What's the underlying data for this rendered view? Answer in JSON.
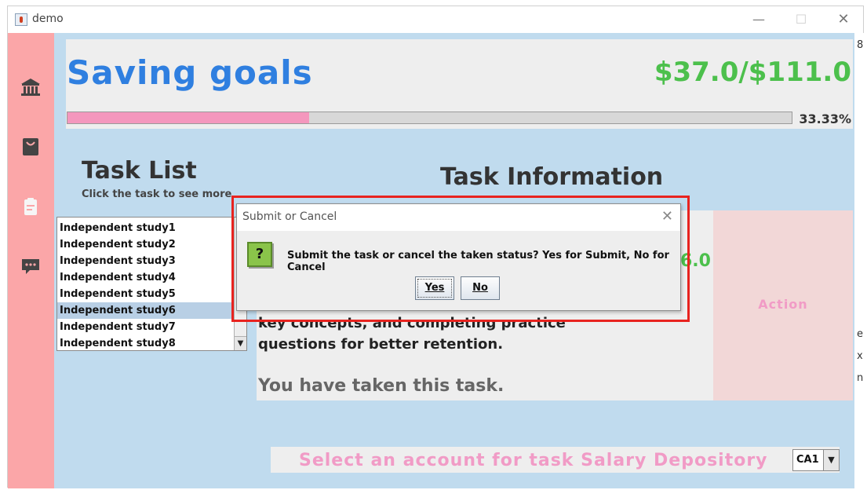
{
  "window": {
    "title": "demo",
    "minimize": "—",
    "maximize": "☐",
    "close": "✕"
  },
  "sidebar": {
    "items": [
      {
        "icon": "bank-icon"
      },
      {
        "icon": "shopping-bag-icon"
      },
      {
        "icon": "clipboard-icon"
      },
      {
        "icon": "chat-icon"
      }
    ]
  },
  "header": {
    "title": "Saving goals",
    "amount": "$37.0/$111.0",
    "progress": 0.3333,
    "percent": "33.33%"
  },
  "task_list": {
    "title": "Task List",
    "subtitle": "Click the task to see more",
    "items": [
      "Independent study1",
      "Independent study2",
      "Independent study3",
      "Independent study4",
      "Independent study5",
      "Independent study6",
      "Independent study7",
      "Independent study8"
    ],
    "selected_index": 5
  },
  "task_info": {
    "title": "Task Information",
    "amount_partial": "6.0",
    "description": "key concepts, and completing practice questions for better retention.",
    "status": "You have taken this task.",
    "action": "Action"
  },
  "account": {
    "label": "Select an account for task Salary Depository",
    "selected": "CA1"
  },
  "dialog": {
    "title": "Submit or Cancel",
    "close": "✕",
    "icon": "question-icon",
    "icon_glyph": "?",
    "message": "Submit the task or cancel the taken status? Yes for Submit, No for Cancel",
    "yes": "Yes",
    "no": "No"
  },
  "colors": {
    "sidebar": "#fba6a8",
    "content": "#c0dbee",
    "title_blue": "#2f7fe0",
    "amount_green": "#4cc04c",
    "progress_pink": "#f497bd",
    "accent_pink": "#f19bc6",
    "highlight_red": "#e8231f"
  }
}
